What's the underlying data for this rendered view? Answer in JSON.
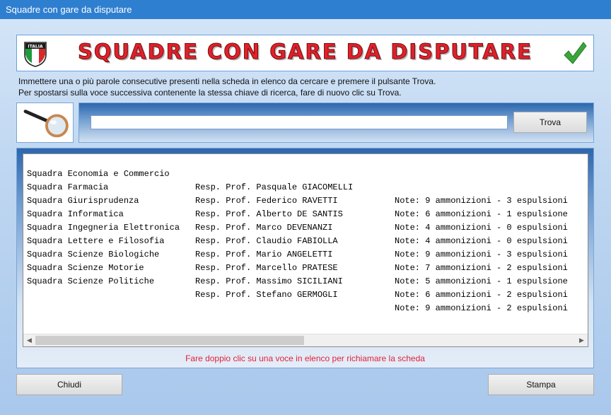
{
  "window": {
    "title": "Squadre con gare da disputare"
  },
  "banner": {
    "title": "SQUADRE CON GARE DA DISPUTARE",
    "flag_text": "ITALIA"
  },
  "instructions": {
    "line1": "Immettere una o più parole consecutive presenti nella scheda in elenco da cercare e premere il pulsante Trova.",
    "line2": "Per spostarsi sulla voce successiva contenente la stessa chiave di ricerca, fare di nuovo clic su Trova."
  },
  "search": {
    "value": "",
    "button_label": "Trova"
  },
  "list": {
    "rows": [
      {
        "squadra": "Squadra Economia e Commercio",
        "resp": "Resp. Prof. Pasquale GIACOMELLI",
        "note": "Note: 9 ammonizioni - 3 espulsioni"
      },
      {
        "squadra": "Squadra Farmacia",
        "resp": "Resp. Prof. Federico RAVETTI",
        "note": "Note: 6 ammonizioni - 1 espulsione"
      },
      {
        "squadra": "Squadra Giurisprudenza",
        "resp": "Resp. Prof. Alberto DE SANTIS",
        "note": "Note: 4 ammonizioni - 0 espulsioni"
      },
      {
        "squadra": "Squadra Informatica",
        "resp": "Resp. Prof. Marco DEVENANZI",
        "note": "Note: 4 ammonizioni - 0 espulsioni"
      },
      {
        "squadra": "Squadra Ingegneria Elettronica",
        "resp": "Resp. Prof. Claudio FABIOLLA",
        "note": "Note: 9 ammonizioni - 3 espulsioni"
      },
      {
        "squadra": "Squadra Lettere e Filosofia",
        "resp": "Resp. Prof. Mario ANGELETTI",
        "note": "Note: 7 ammonizioni - 2 espulsioni"
      },
      {
        "squadra": "Squadra Scienze Biologiche",
        "resp": "Resp. Prof. Marcello PRATESE",
        "note": "Note: 5 ammonizioni - 1 espulsione"
      },
      {
        "squadra": "Squadra Scienze Motorie",
        "resp": "Resp. Prof. Massimo SICILIANI",
        "note": "Note: 6 ammonizioni - 2 espulsioni"
      },
      {
        "squadra": "Squadra Scienze Politiche",
        "resp": "Resp. Prof. Stefano GERMOGLI",
        "note": "Note: 9 ammonizioni - 2 espulsioni"
      }
    ],
    "hint": "Fare doppio clic su una voce in elenco per richiamare la scheda"
  },
  "footer": {
    "close_label": "Chiudi",
    "print_label": "Stampa"
  },
  "icons": {
    "flag": "italia-shield-icon",
    "check": "checkmark-icon",
    "magnifier": "magnifier-icon",
    "scroll_left": "arrow-left-icon",
    "scroll_right": "arrow-right-icon"
  },
  "colors": {
    "banner_title": "#e0212a",
    "hint": "#e2223a",
    "check": "#3aa63a"
  }
}
